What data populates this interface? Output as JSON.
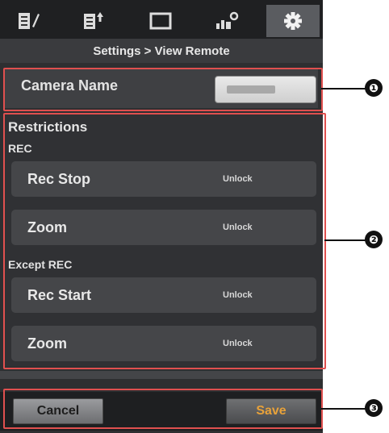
{
  "tabs": [
    {
      "icon": "edit-list-icon"
    },
    {
      "icon": "upload-list-icon"
    },
    {
      "icon": "display-icon"
    },
    {
      "icon": "camera-settings-icon"
    },
    {
      "icon": "gear-icon",
      "active": true
    }
  ],
  "header": {
    "title": "Settings > View Remote"
  },
  "camera": {
    "label": "Camera Name"
  },
  "restrictions": {
    "title": "Restrictions",
    "rec_label": "REC",
    "rec_items": [
      {
        "label": "Rec Stop",
        "state": "Unlock"
      },
      {
        "label": "Zoom",
        "state": "Unlock"
      }
    ],
    "except_label": "Except REC",
    "except_items": [
      {
        "label": "Rec Start",
        "state": "Unlock"
      },
      {
        "label": "Zoom",
        "state": "Unlock"
      }
    ]
  },
  "buttons": {
    "cancel": "Cancel",
    "save": "Save"
  },
  "callouts": [
    "❶",
    "❷",
    "❸"
  ],
  "colors": {
    "highlight": "#e0504f",
    "save_text": "#e8a23a"
  }
}
